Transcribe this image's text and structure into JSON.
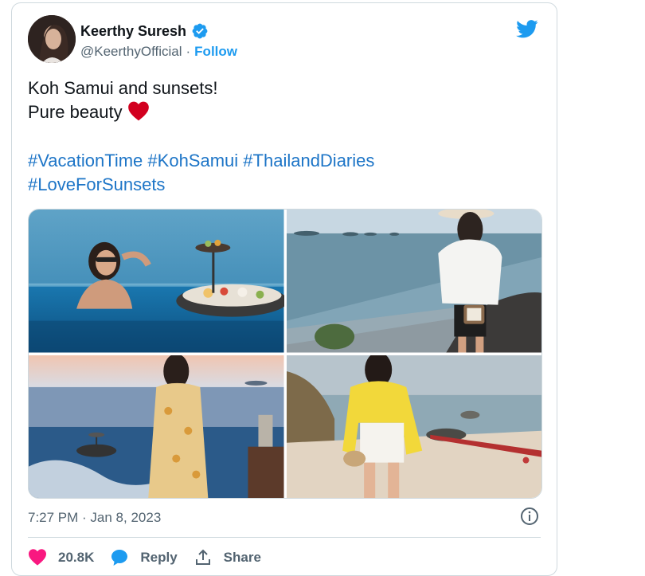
{
  "tweet": {
    "author": {
      "name": "Keerthy Suresh",
      "handle": "@KeerthyOfficial",
      "separator": "·",
      "follow_label": "Follow"
    },
    "text_lines": [
      "Koh Samui and sunsets!",
      "Pure beauty"
    ],
    "emoji": "red-heart",
    "hashtags": [
      "#VacationTime",
      "#KohSamui",
      "#ThailandDiaries",
      "#LoveForSunsets"
    ],
    "photos": [
      {
        "name": "pool-floating-breakfast-photo"
      },
      {
        "name": "ocean-view-balcony-photo"
      },
      {
        "name": "infinity-pool-sunset-photo"
      },
      {
        "name": "beach-yellow-shirt-photo"
      }
    ],
    "timestamp": "7:27 PM · Jan 8, 2023",
    "actions": {
      "likes": "20.8K",
      "reply_label": "Reply",
      "share_label": "Share"
    }
  },
  "colors": {
    "accent": "#1d9bf0",
    "hashtag": "#1d75c7",
    "like": "#f91880",
    "muted": "#536471"
  }
}
